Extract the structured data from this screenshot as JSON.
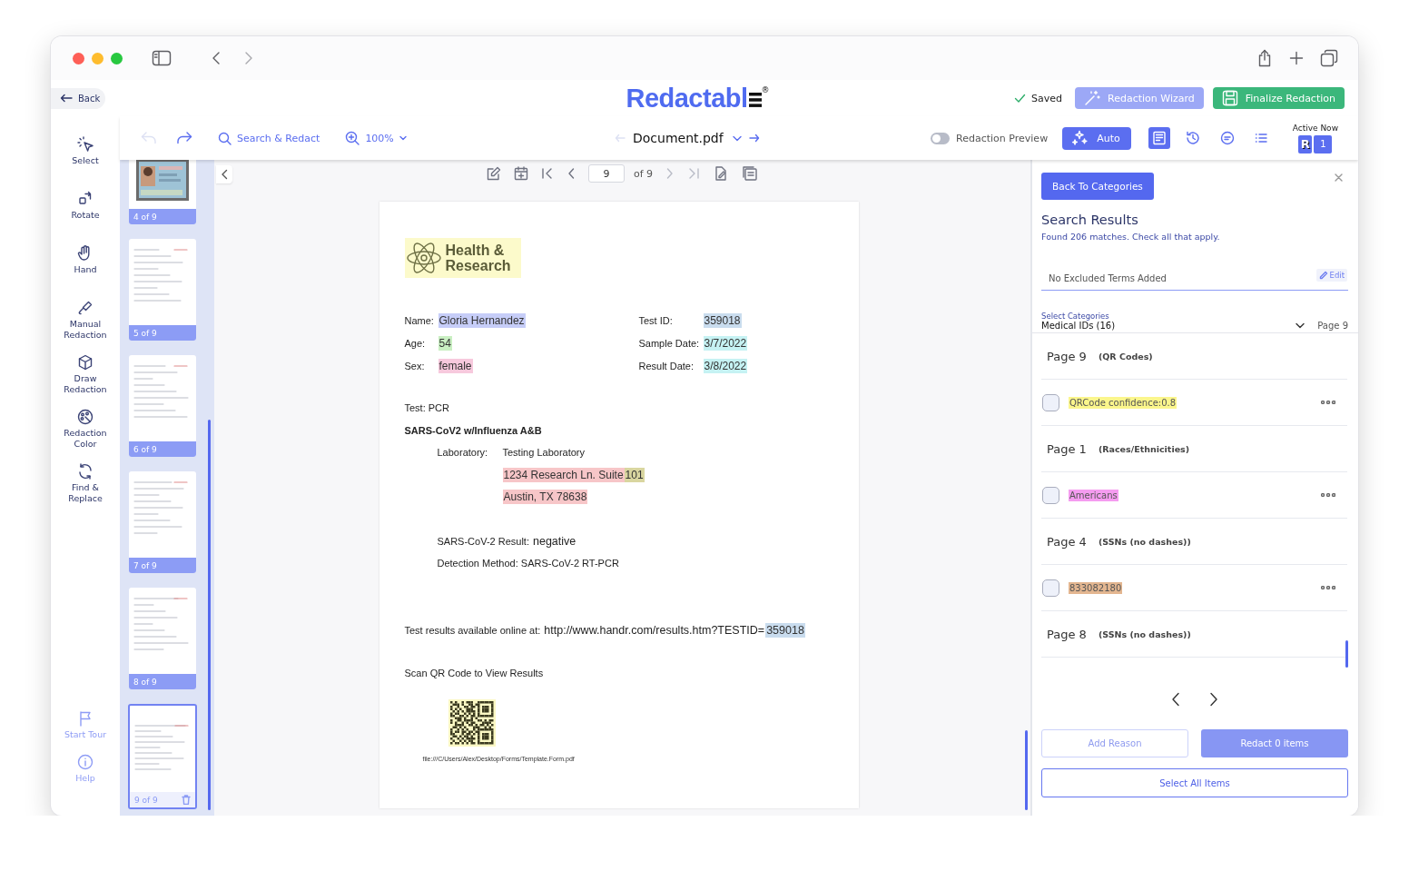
{
  "header": {
    "back": "Back",
    "logo": {
      "text": "Redactabl",
      "mark": "®"
    },
    "saved": "Saved",
    "wizard_button": "Redaction Wizard",
    "finalize_button": "Finalize Redaction"
  },
  "toolbar": {
    "undo_disabled": true,
    "search": "Search & Redact",
    "zoom": "100%",
    "document": "Document.pdf",
    "preview": {
      "label": "Redaction Preview",
      "on": false
    },
    "auto": "Auto",
    "active_now": "Active Now",
    "avatar": "R",
    "user_count": "1"
  },
  "tools": [
    {
      "label": "Select"
    },
    {
      "label": "Rotate"
    },
    {
      "label": "Hand"
    },
    {
      "label": "Manual Redaction"
    },
    {
      "label": "Draw Redaction"
    },
    {
      "label": "Redaction Color"
    },
    {
      "label": "Find & Replace"
    }
  ],
  "footer_tools": [
    {
      "label": "Start Tour"
    },
    {
      "label": "Help"
    }
  ],
  "thumbnails": [
    {
      "label": "4 of 9",
      "selected": false,
      "kind": "picture"
    },
    {
      "label": "5 of 9",
      "selected": false,
      "kind": "document"
    },
    {
      "label": "6 of 9",
      "selected": false,
      "kind": "document"
    },
    {
      "label": "7 of 9",
      "selected": false,
      "kind": "document"
    },
    {
      "label": "8 of 9",
      "selected": false,
      "kind": "document"
    },
    {
      "label": "9 of 9",
      "selected": true,
      "kind": "document"
    }
  ],
  "page_nav": {
    "page": "9",
    "of": "of 9"
  },
  "document": {
    "logo": [
      "Health &",
      "Research"
    ],
    "fields_left": [
      {
        "label": "Name:",
        "value": "Gloria Hernandez",
        "color": "#c6cdf8"
      },
      {
        "label": "Age:",
        "value": "54",
        "color": "#c9efc2"
      },
      {
        "label": "Sex:",
        "value": "female",
        "color": "#f7c9dd"
      }
    ],
    "fields_right": [
      {
        "label": "Test ID:",
        "value": "359018",
        "color": "#c9dcee"
      },
      {
        "label": "Sample Date:",
        "value": "3/7/2022",
        "color": "#c6f2f3"
      },
      {
        "label": "Result Date:",
        "value": "3/8/2022",
        "color": "#c6f2f3"
      }
    ],
    "test": "Test: PCR",
    "panel": "SARS-CoV2 w/Influenza A&B",
    "lab": {
      "label": "Laboratory:",
      "name": "Testing Laboratory",
      "address": [
        [
          {
            "text": "1234 Research Ln. Suite ",
            "color": "#f7c6c8"
          },
          {
            "text": "101",
            "color": "#d9d6a0"
          }
        ],
        [
          {
            "text": "Austin, TX 78638",
            "color": "#f7c6c8"
          }
        ]
      ]
    },
    "result": {
      "label": "SARS-CoV-2 Result:",
      "value": "negative"
    },
    "method": "Detection Method: SARS-CoV-2 RT-PCR",
    "online": {
      "label": "Test results available online at:",
      "url": [
        {
          "text": "http://www.handr.com/results.htm?TESTID="
        },
        {
          "text": "359018",
          "color": "#c9dcee"
        }
      ]
    },
    "scan": "Scan QR Code to View Results",
    "footnote": "file:///C/Users/Alex/Desktop/Forms/Template.Form.pdf"
  },
  "panel": {
    "back_button": "Back To Categories",
    "title": "Search Results",
    "subtitle": "Found 206 matches. Check all that apply.",
    "excluded_placeholder": "No Excluded Terms Added",
    "edit": "Edit",
    "category_label": "Select Categories",
    "category": "Medical IDs (16)",
    "page": "Page 9",
    "groups": [
      {
        "page": "Page 9",
        "category": "(QR Codes)",
        "items": [
          {
            "text": "QRCode confidence:0.8",
            "color": "#fbf68c",
            "checked": false
          }
        ]
      },
      {
        "page": "Page 1",
        "category": "(Races/Ethnicities)",
        "items": [
          {
            "text": "Americans",
            "color": "#f59cf0",
            "checked": false
          }
        ]
      },
      {
        "page": "Page 4",
        "category": "(SSNs (no dashes))",
        "items": [
          {
            "text": "833082180",
            "color": "#e3b690",
            "checked": false
          }
        ]
      },
      {
        "page": "Page 8",
        "category": "(SSNs (no dashes))"
      }
    ],
    "add_reason": {
      "label": "Add Reason",
      "disabled": true
    },
    "redact": {
      "label": "Redact 0 items",
      "disabled": true
    },
    "select_all": "Select All Items"
  }
}
